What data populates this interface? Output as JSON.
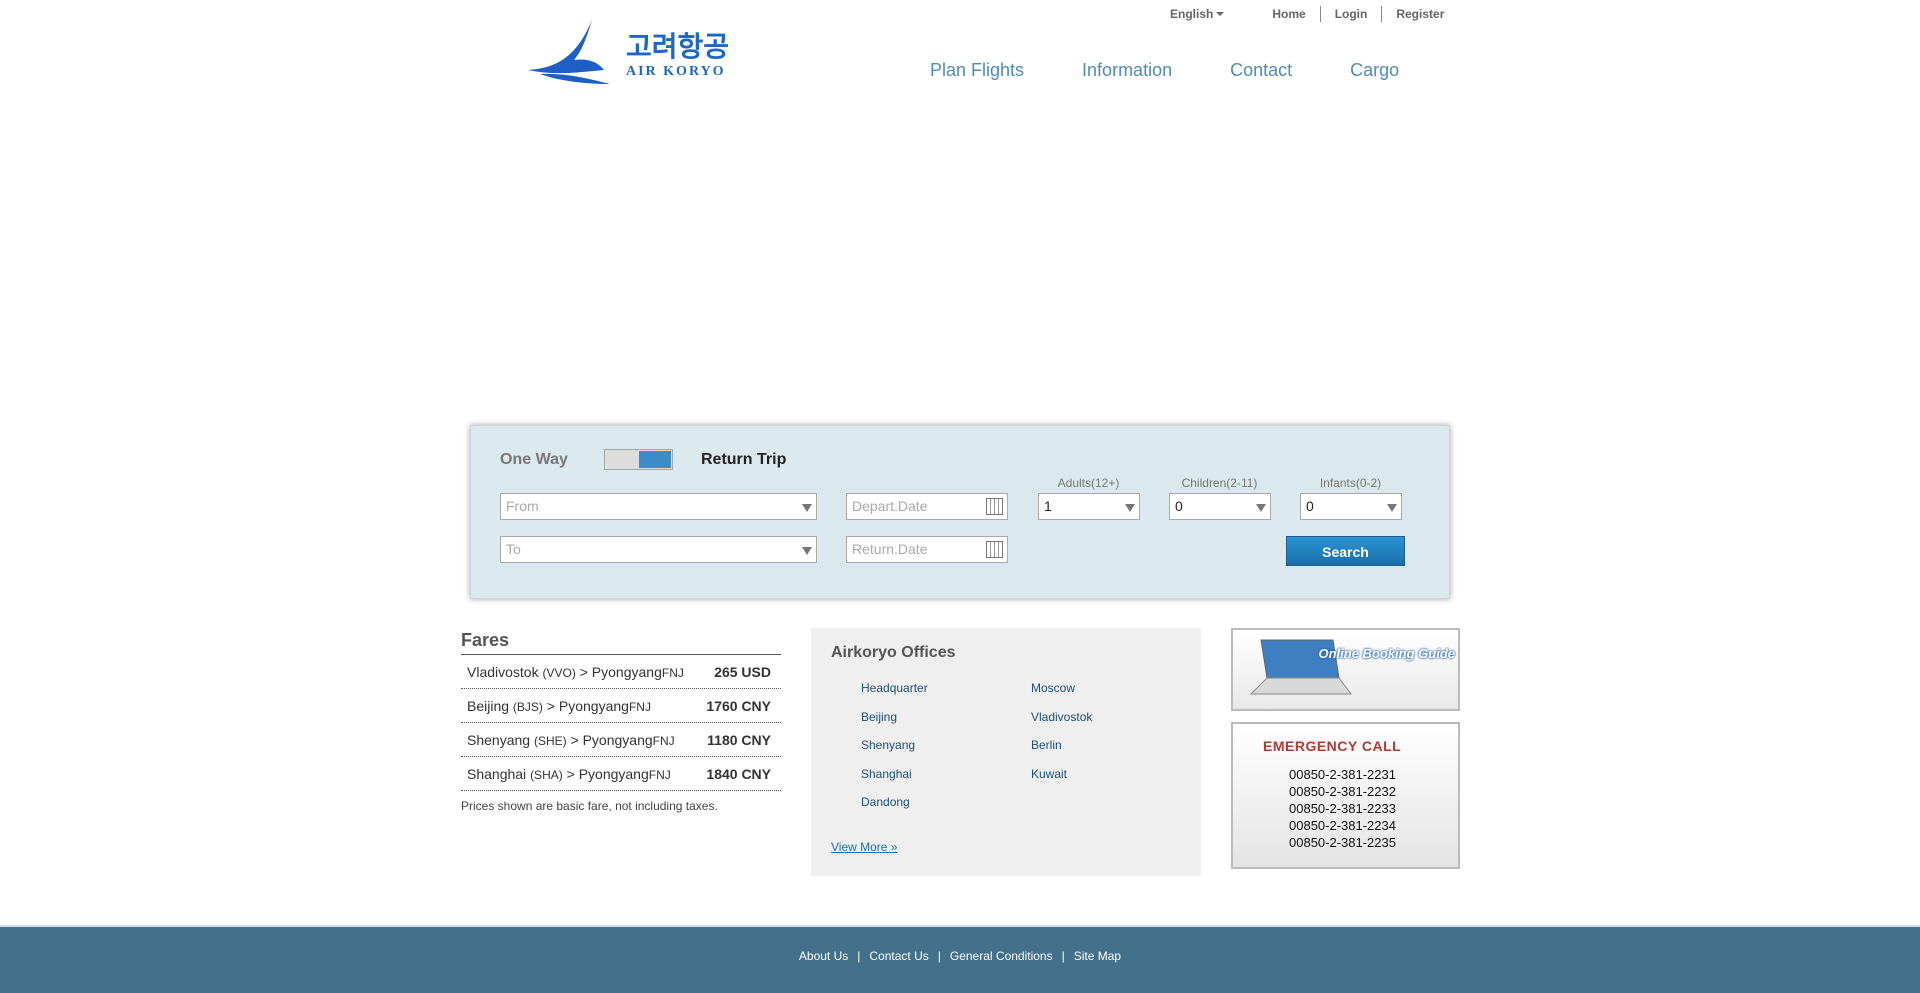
{
  "header": {
    "language": "English",
    "links": [
      "Home",
      "Login",
      "Register"
    ],
    "logo_text": "AIR KORYO",
    "logo_korean": "고려항공"
  },
  "nav": [
    "Plan Flights",
    "Information",
    "Contact",
    "Cargo"
  ],
  "booking": {
    "one_way": "One Way",
    "return_trip": "Return Trip",
    "from_placeholder": "From",
    "to_placeholder": "To",
    "depart_placeholder": "Depart.Date",
    "return_placeholder": "Return.Date",
    "adults_label": "Adults(12+)",
    "children_label": "Children(2-11)",
    "infants_label": "Infants(0-2)",
    "adults_value": "1",
    "children_value": "0",
    "infants_value": "0",
    "search_label": "Search"
  },
  "fares": {
    "title": "Fares",
    "rows": [
      {
        "from": "Vladivostok",
        "code": "(VVO)",
        "to": "Pyongyang",
        "to_code": "FNJ",
        "price": "265 USD"
      },
      {
        "from": "Beijing",
        "code": "(BJS)",
        "to": "Pyongyang",
        "to_code": "FNJ",
        "price": "1760 CNY"
      },
      {
        "from": "Shenyang",
        "code": "(SHE)",
        "to": "Pyongyang",
        "to_code": "FNJ",
        "price": "1180 CNY"
      },
      {
        "from": "Shanghai",
        "code": "(SHA)",
        "to": "Pyongyang",
        "to_code": "FNJ",
        "price": "1840 CNY"
      }
    ],
    "note": "Prices shown are basic fare, not including taxes."
  },
  "offices": {
    "title": "Airkoryo Offices",
    "col1": [
      "Headquarter",
      "Beijing",
      "Shenyang",
      "Shanghai",
      "Dandong"
    ],
    "col2": [
      "Moscow",
      "Vladivostok",
      "Berlin",
      "Kuwait"
    ],
    "view_more": "View More »"
  },
  "guide": {
    "text": "Online Booking Guide"
  },
  "emergency": {
    "title": "EMERGENCY CALL",
    "phones": [
      "00850-2-381-2231",
      "00850-2-381-2232",
      "00850-2-381-2233",
      "00850-2-381-2234",
      "00850-2-381-2235"
    ]
  },
  "footer": {
    "links": [
      "About Us",
      "Contact Us",
      "General Conditions",
      "Site Map"
    ]
  }
}
